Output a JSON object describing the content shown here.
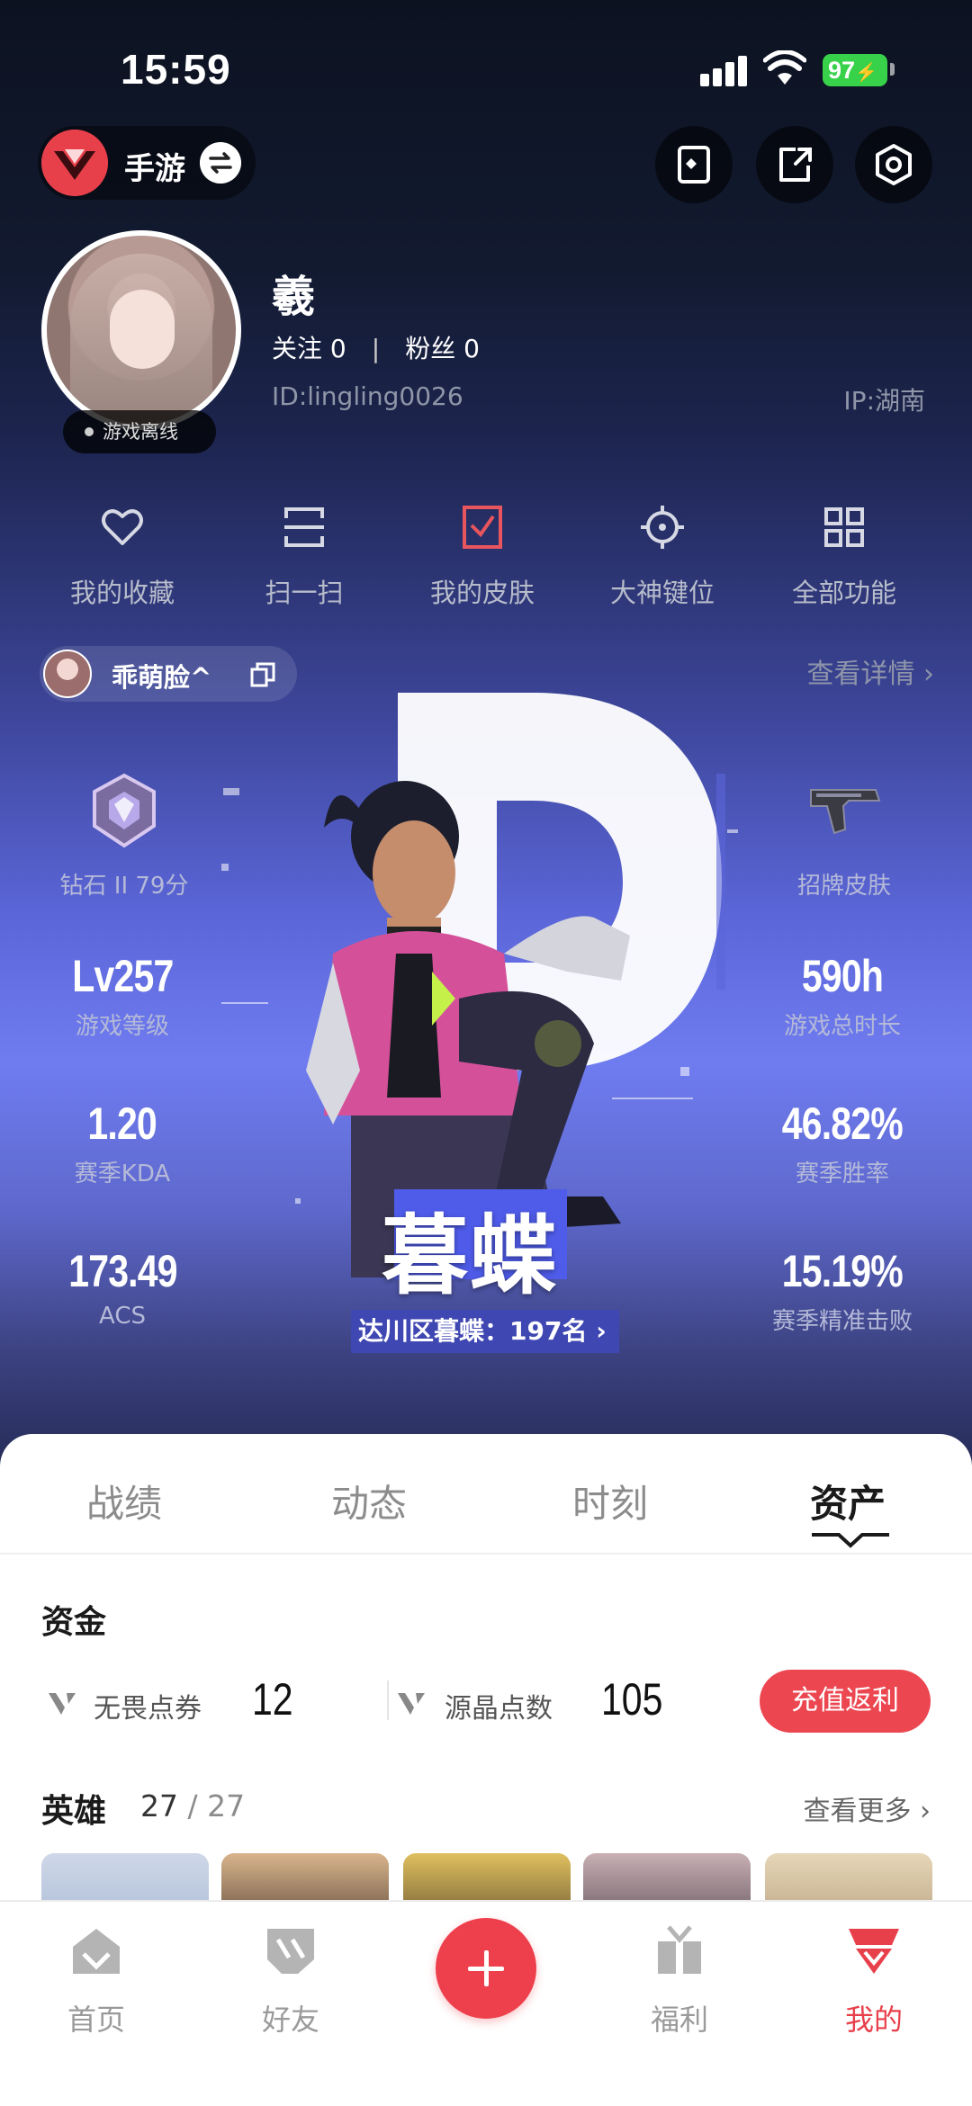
{
  "status_bar": {
    "time": "15:59",
    "battery": "97"
  },
  "header": {
    "app_switch_label": "手游"
  },
  "profile": {
    "nickname": "羲",
    "following_label": "关注",
    "following_count": "0",
    "fans_label": "粉丝",
    "fans_count": "0",
    "separator": "|",
    "id_text": "ID:lingling0026",
    "ip_text": "IP:湖南",
    "online_status": "游戏离线"
  },
  "quick_actions": [
    {
      "label": "我的收藏",
      "icon": "heart-icon"
    },
    {
      "label": "扫一扫",
      "icon": "scan-icon"
    },
    {
      "label": "我的皮肤",
      "icon": "skin-icon"
    },
    {
      "label": "大神键位",
      "icon": "crosshair-icon"
    },
    {
      "label": "全部功能",
      "icon": "grid-icon"
    }
  ],
  "game_account": {
    "nickname": "乖萌脸^",
    "detail_link": "查看详情"
  },
  "stats": {
    "rank": {
      "label": "钻石 II 79分",
      "icon": "diamond-rank-icon"
    },
    "skin": {
      "label": "招牌皮肤",
      "icon": "pistol-skin-icon"
    },
    "level": {
      "value": "Lv257",
      "label": "游戏等级"
    },
    "playtime": {
      "value": "590h",
      "label": "游戏总时长"
    },
    "kda": {
      "value": "1.20",
      "label": "赛季KDA"
    },
    "winrate": {
      "value": "46.82%",
      "label": "赛季胜率"
    },
    "acs": {
      "value": "173.49",
      "label": "ACS"
    },
    "precision": {
      "value": "15.19%",
      "label": "赛季精准击败"
    }
  },
  "agent": {
    "name": "暮蝶",
    "rank_text": "达川区暮蝶：197名 ›"
  },
  "tabs": [
    {
      "label": "战绩",
      "active": false
    },
    {
      "label": "动态",
      "active": false
    },
    {
      "label": "时刻",
      "active": false
    },
    {
      "label": "资产",
      "active": true
    }
  ],
  "funds": {
    "title": "资金",
    "items": [
      {
        "label": "无畏点券",
        "value": "12"
      },
      {
        "label": "源晶点数",
        "value": "105"
      }
    ],
    "recharge_label": "充值返利"
  },
  "heroes": {
    "title": "英雄",
    "owned": "27",
    "total": "/ 27",
    "more_link": "查看更多"
  },
  "tabbar": [
    {
      "label": "首页",
      "icon": "home-icon",
      "active": false
    },
    {
      "label": "好友",
      "icon": "friends-icon",
      "active": false
    },
    {
      "label": "福利",
      "icon": "gift-icon",
      "active": false
    },
    {
      "label": "我的",
      "icon": "profile-icon",
      "active": true
    }
  ],
  "colors": {
    "accent": "#e8404b",
    "hero_gradient_mid": "#6f7cf0",
    "agent_highlight": "#4f5cea"
  }
}
